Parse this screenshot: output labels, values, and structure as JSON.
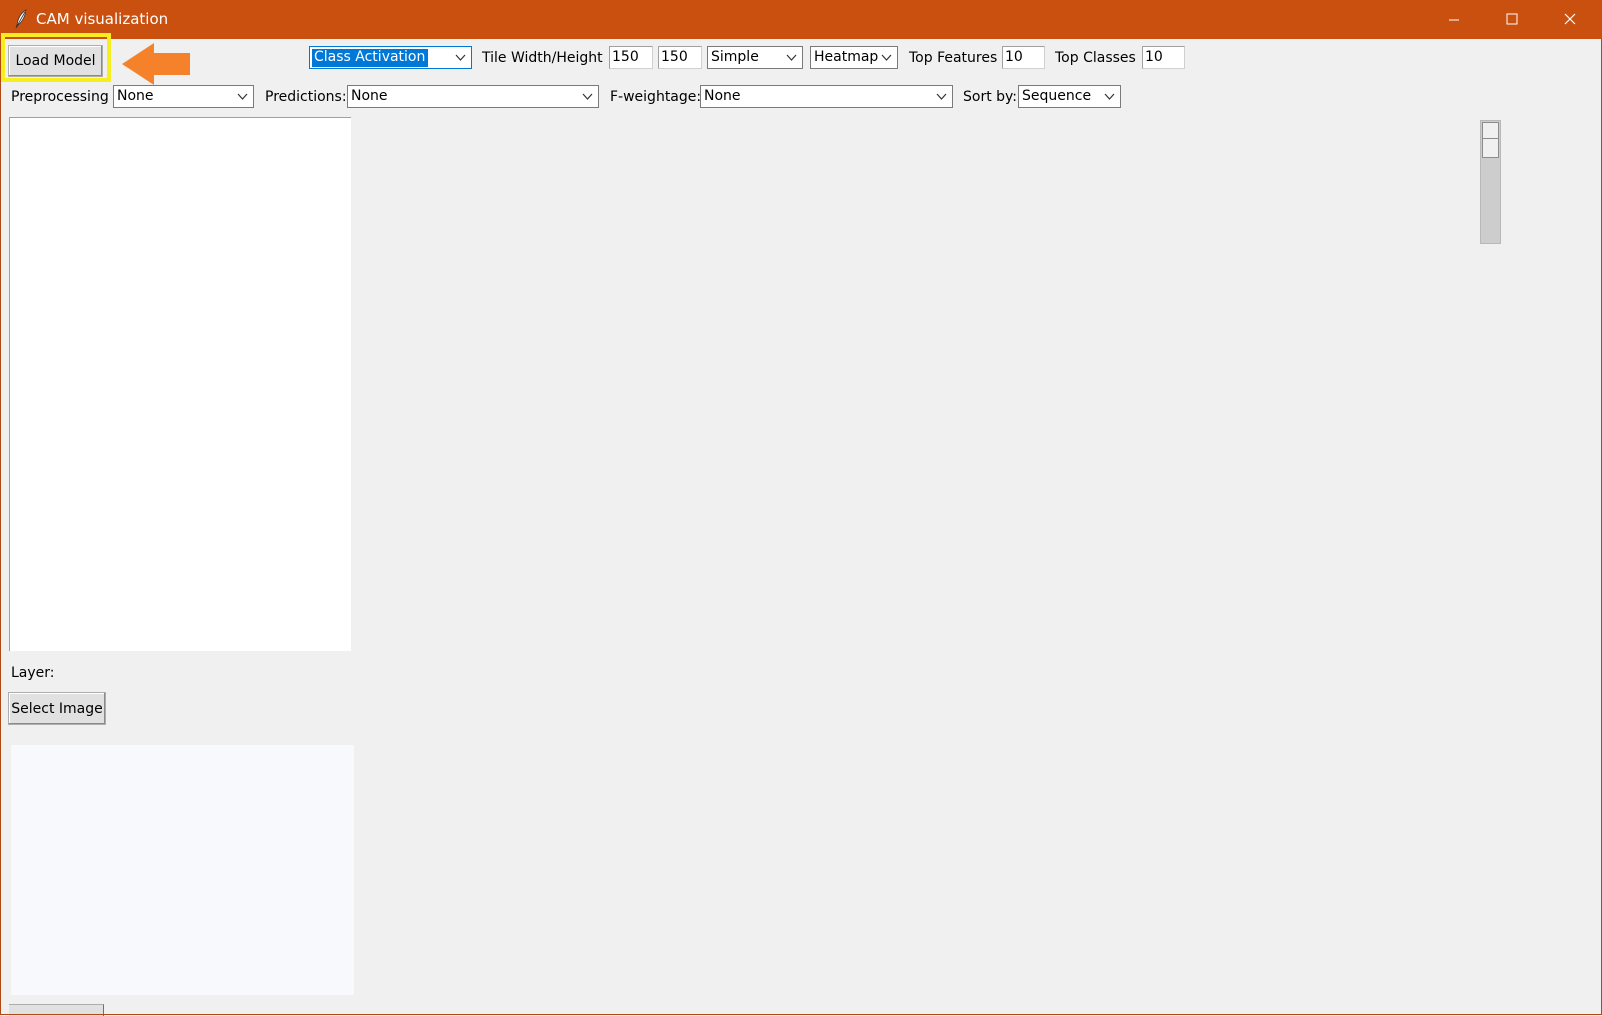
{
  "window": {
    "title": "CAM visualization",
    "titlebar_color": "#ca5010",
    "icons": {
      "app": "feather-icon",
      "minimize": "minimize-icon",
      "maximize": "maximize-icon",
      "close": "close-icon"
    }
  },
  "toolbar": {
    "load_model_label": "Load Model",
    "annotation_arrow_color": "#f5822a",
    "annotation_box_color": "#f7ee1d",
    "mode_value": "Class Activation",
    "tile_size_label": "Tile Width/Height",
    "tile_width": "150",
    "tile_height": "150",
    "style_value": "Simple",
    "display_value": "Heatmap",
    "top_features_label": "Top Features",
    "top_features_value": "10",
    "top_classes_label": "Top Classes",
    "top_classes_value": "10"
  },
  "filters": {
    "preprocessing_label": "Preprocessing",
    "preprocessing_value": "None",
    "predictions_label": "Predictions:",
    "predictions_value": "None",
    "fweightage_label": "F-weightage:",
    "fweightage_value": "None",
    "sortby_label": "Sort by:",
    "sortby_value": "Sequence"
  },
  "left_panel": {
    "layer_label": "Layer:",
    "select_image_label": "Select Image"
  }
}
